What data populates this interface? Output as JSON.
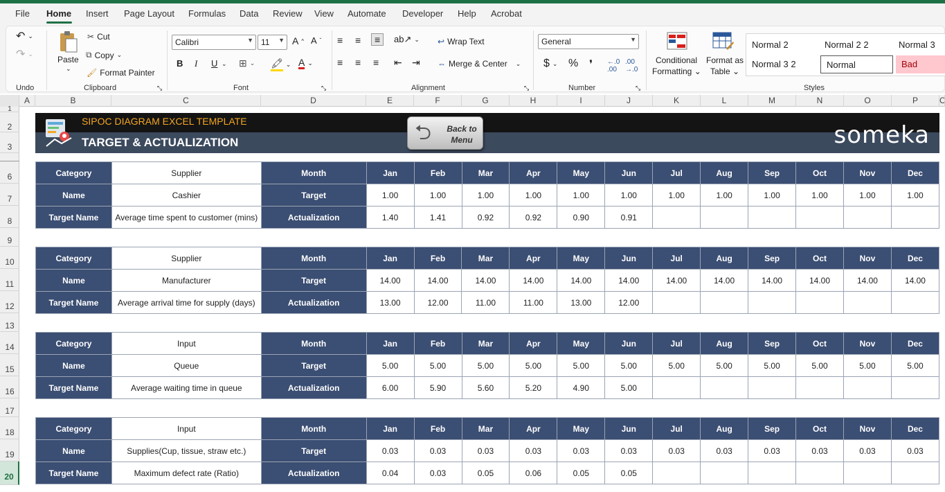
{
  "menu": [
    "File",
    "Home",
    "Insert",
    "Page Layout",
    "Formulas",
    "Data",
    "Review",
    "View",
    "Automate",
    "Developer",
    "Help",
    "Acrobat"
  ],
  "ribbon": {
    "undo_label": "Undo",
    "clipboard": {
      "paste": "Paste",
      "cut": "Cut",
      "copy": "Copy",
      "format_painter": "Format Painter",
      "label": "Clipboard"
    },
    "font": {
      "name": "Calibri",
      "size": "11",
      "label": "Font",
      "bold": "B",
      "italic": "I",
      "underline": "U"
    },
    "alignment": {
      "wrap": "Wrap Text",
      "merge": "Merge & Center",
      "label": "Alignment"
    },
    "number": {
      "format": "General",
      "label": "Number",
      "currency": "$",
      "percent": "%",
      "comma": "❜"
    },
    "conditional": {
      "line1": "Conditional",
      "line2": "Formatting"
    },
    "format_table": {
      "line1": "Format as",
      "line2": "Table"
    },
    "styles": {
      "label": "Styles",
      "items": [
        "Normal 2",
        "Normal 2 2",
        "Normal 3",
        "Normal 3 2",
        "Normal",
        "Bad"
      ]
    }
  },
  "columns": [
    "A",
    "B",
    "C",
    "D",
    "E",
    "F",
    "G",
    "H",
    "I",
    "J",
    "K",
    "L",
    "M",
    "N",
    "O",
    "P",
    "C"
  ],
  "rows": [
    "1",
    "2",
    "3",
    "6",
    "7",
    "8",
    "9",
    "10",
    "11",
    "12",
    "13",
    "14",
    "15",
    "16",
    "17",
    "18",
    "19",
    "20"
  ],
  "banner": {
    "subtitle": "SIPOC DIAGRAM EXCEL TEMPLATE",
    "title": "TARGET & ACTUALIZATION",
    "back_button": "Back to Menu",
    "brand": "someka"
  },
  "labels": {
    "category": "Category",
    "name": "Name",
    "target_name": "Target Name",
    "month": "Month",
    "target": "Target",
    "actualization": "Actualization"
  },
  "months": [
    "Jan",
    "Feb",
    "Mar",
    "Apr",
    "May",
    "Jun",
    "Jul",
    "Aug",
    "Sep",
    "Oct",
    "Nov",
    "Dec"
  ],
  "tables": [
    {
      "category": "Supplier",
      "name": "Cashier",
      "target_name": "Average time spent to customer (mins)",
      "target": [
        "1.00",
        "1.00",
        "1.00",
        "1.00",
        "1.00",
        "1.00",
        "1.00",
        "1.00",
        "1.00",
        "1.00",
        "1.00",
        "1.00"
      ],
      "actual": [
        "1.40",
        "1.41",
        "0.92",
        "0.92",
        "0.90",
        "0.91",
        "",
        "",
        "",
        "",
        "",
        ""
      ]
    },
    {
      "category": "Supplier",
      "name": "Manufacturer",
      "target_name": "Average arrival time for supply (days)",
      "target": [
        "14.00",
        "14.00",
        "14.00",
        "14.00",
        "14.00",
        "14.00",
        "14.00",
        "14.00",
        "14.00",
        "14.00",
        "14.00",
        "14.00"
      ],
      "actual": [
        "13.00",
        "12.00",
        "11.00",
        "11.00",
        "13.00",
        "12.00",
        "",
        "",
        "",
        "",
        "",
        ""
      ]
    },
    {
      "category": "Input",
      "name": "Queue",
      "target_name": "Average waiting time in queue",
      "target": [
        "5.00",
        "5.00",
        "5.00",
        "5.00",
        "5.00",
        "5.00",
        "5.00",
        "5.00",
        "5.00",
        "5.00",
        "5.00",
        "5.00"
      ],
      "actual": [
        "6.00",
        "5.90",
        "5.60",
        "5.20",
        "4.90",
        "5.00",
        "",
        "",
        "",
        "",
        "",
        ""
      ]
    },
    {
      "category": "Input",
      "name": "Supplies(Cup, tissue, straw etc.)",
      "target_name": "Maximum defect rate (Ratio)",
      "target": [
        "0.03",
        "0.03",
        "0.03",
        "0.03",
        "0.03",
        "0.03",
        "0.03",
        "0.03",
        "0.03",
        "0.03",
        "0.03",
        "0.03"
      ],
      "actual": [
        "0.04",
        "0.03",
        "0.05",
        "0.06",
        "0.05",
        "0.05",
        "",
        "",
        "",
        "",
        "",
        ""
      ]
    }
  ]
}
